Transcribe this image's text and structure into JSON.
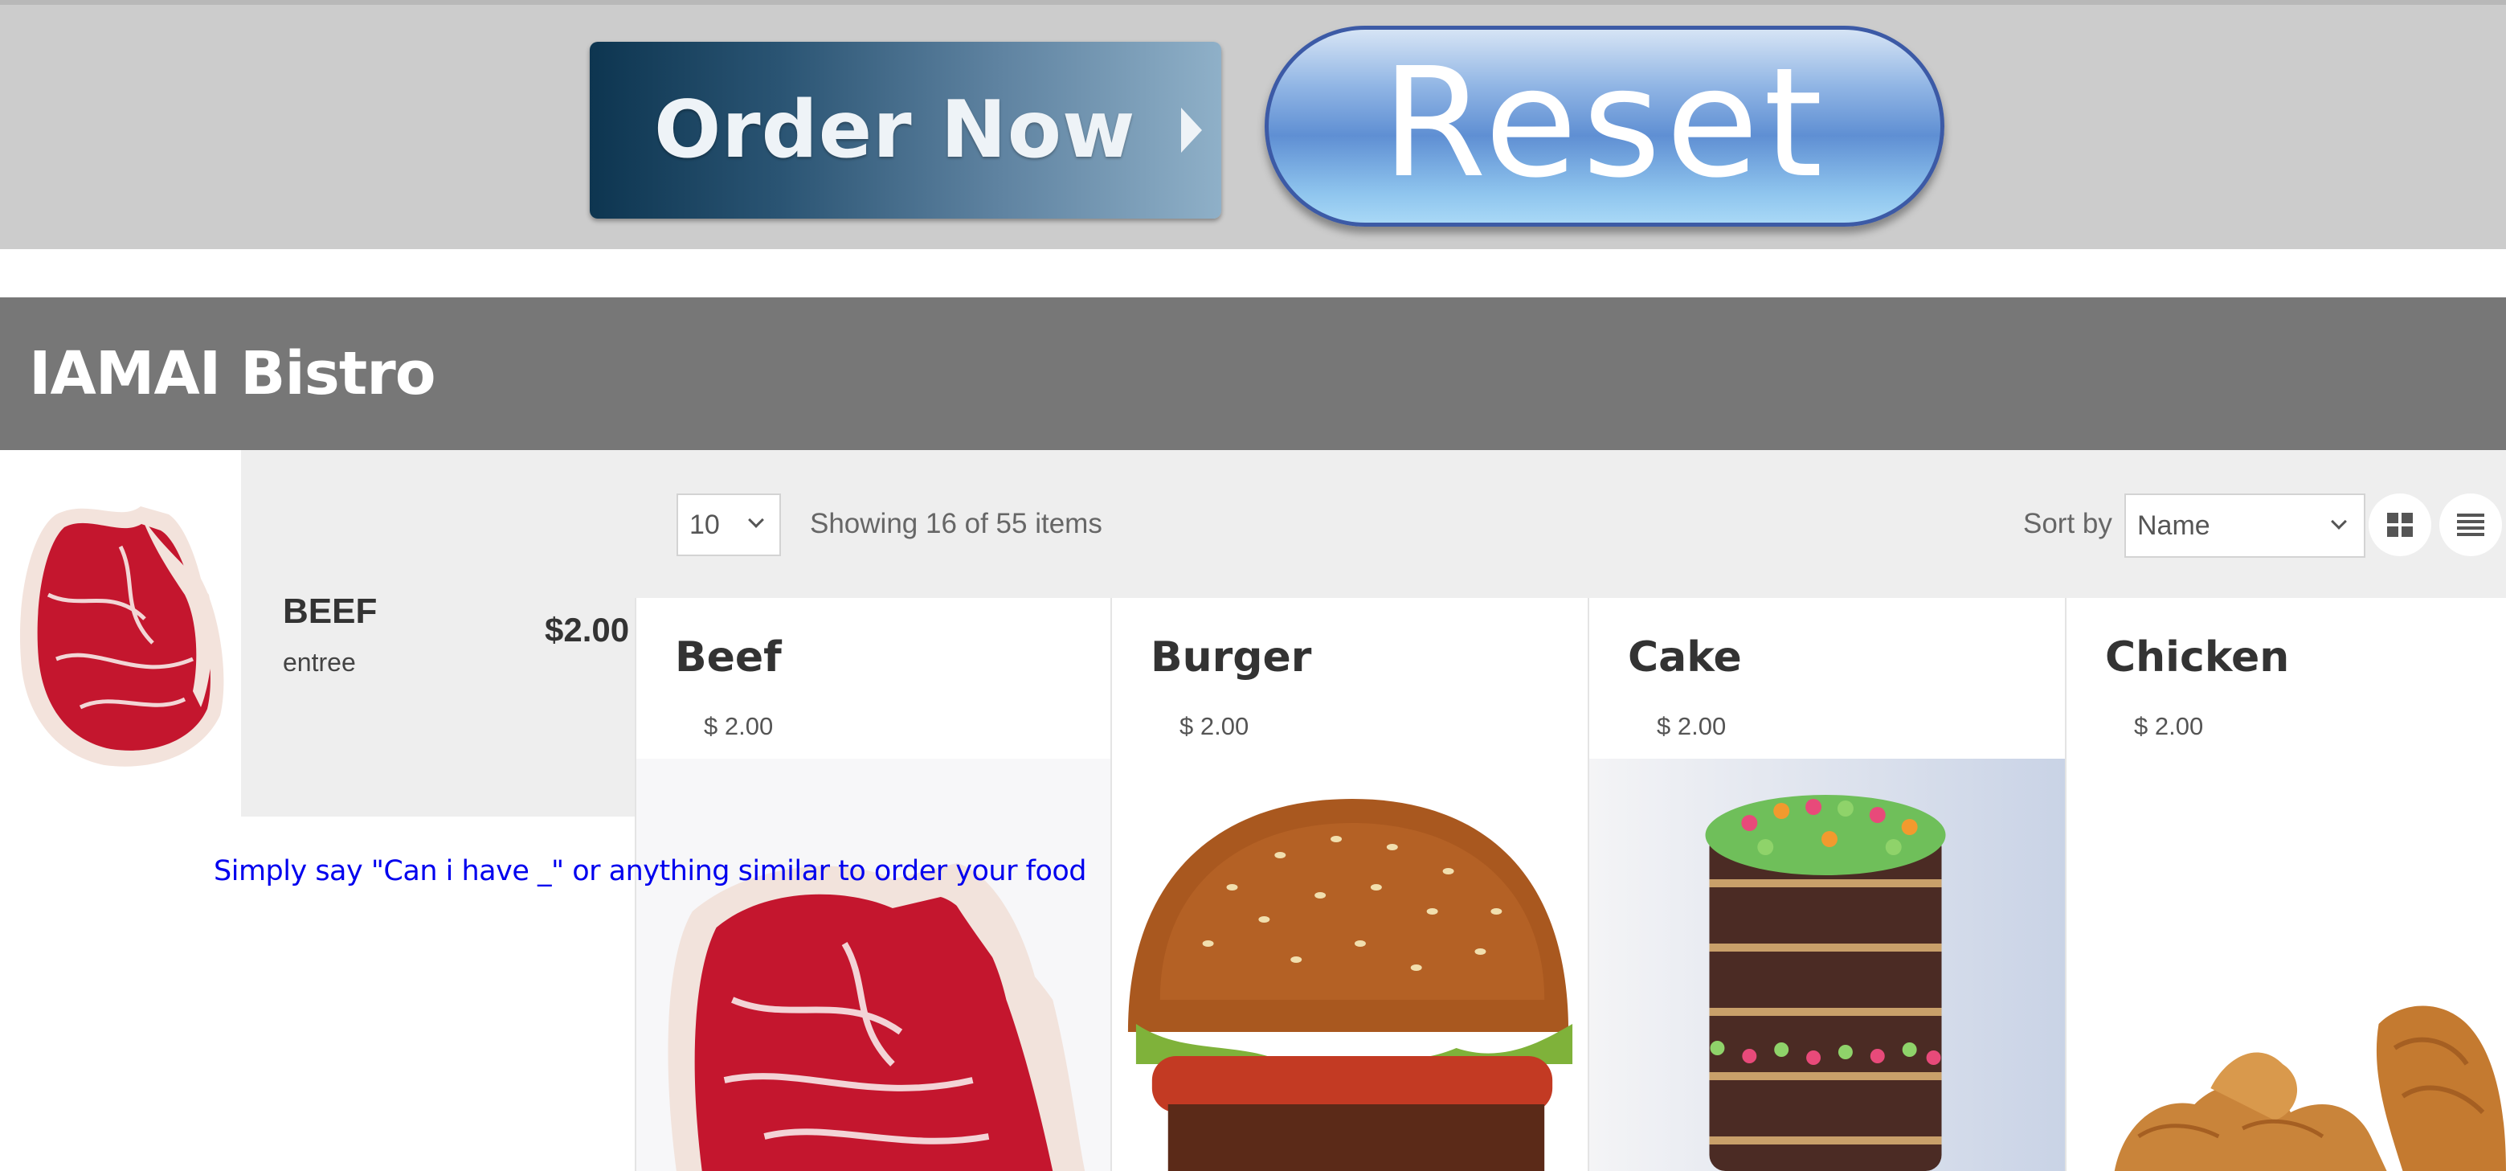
{
  "actions": {
    "order_label": "Order Now",
    "reset_label": "Reset"
  },
  "header": {
    "title": "IAMAI Bistro"
  },
  "cart": {
    "item": {
      "name": "BEEF",
      "category": "entree",
      "price": "$2.00",
      "image": "beef-steak"
    }
  },
  "hint": "Simply say \"Can i have _\" or anything similar to order your food",
  "toolbar": {
    "per_page": "10",
    "showing": "Showing 16 of 55 items",
    "sort_label": "Sort by",
    "sort_value": "Name",
    "view_icons": [
      "grid-view-icon",
      "list-view-icon"
    ]
  },
  "products": [
    {
      "name": "Beef",
      "price": "$ 2.00",
      "image": "beef-steak"
    },
    {
      "name": "Burger",
      "price": "$ 2.00",
      "image": "burger"
    },
    {
      "name": "Cake",
      "price": "$ 2.00",
      "image": "layer-cake"
    },
    {
      "name": "Chicken",
      "price": "$ 2.00",
      "image": "fried-chicken"
    }
  ],
  "colors": {
    "topbar": "#cccccc",
    "header": "#777777",
    "panel": "#eeeeee",
    "hint": "#0000ee"
  }
}
